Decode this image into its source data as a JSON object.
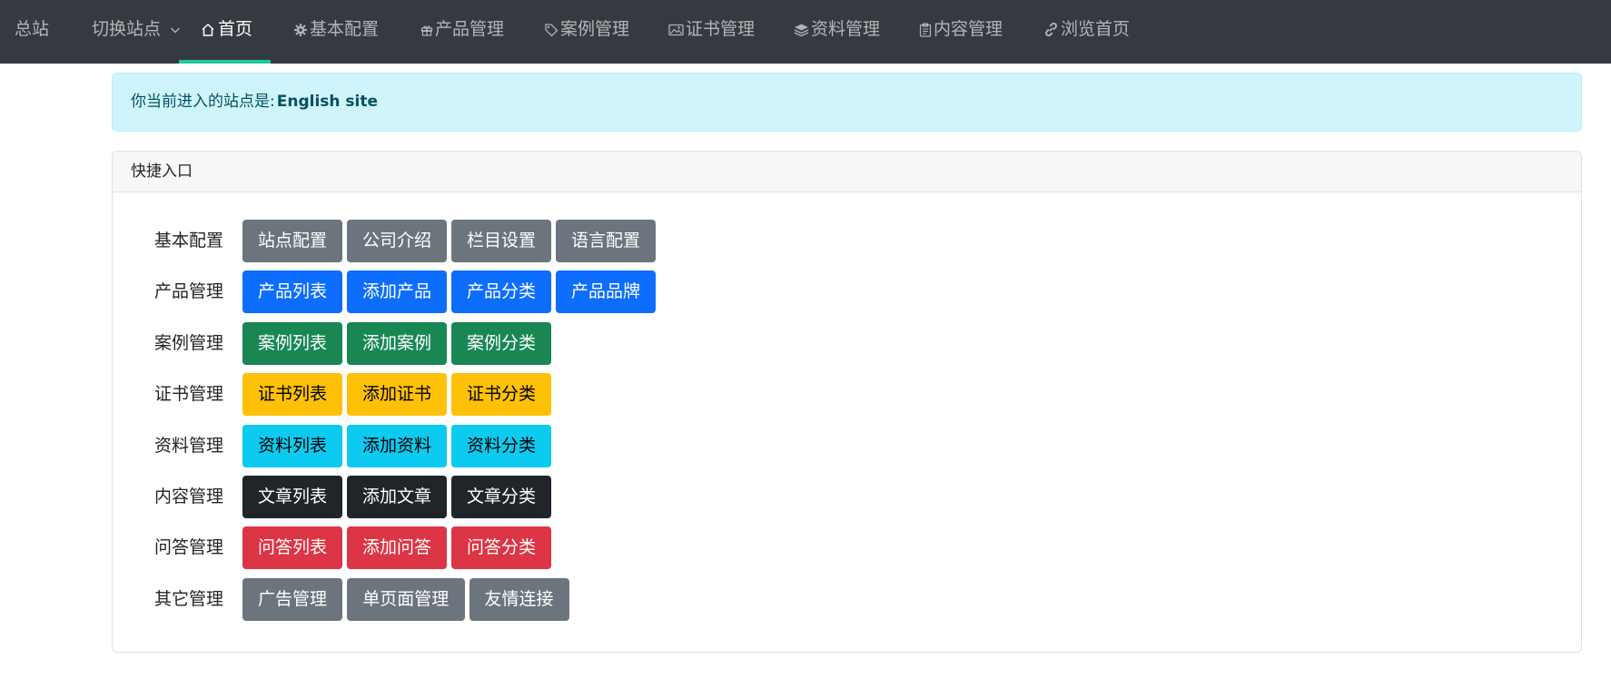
{
  "nav": {
    "brand": "总站",
    "switch_site": "切换站点",
    "items": [
      {
        "label": "首页",
        "icon": "home-icon"
      },
      {
        "label": "基本配置",
        "icon": "gear-icon"
      },
      {
        "label": "产品管理",
        "icon": "gift-icon"
      },
      {
        "label": "案例管理",
        "icon": "tag-icon"
      },
      {
        "label": "证书管理",
        "icon": "image-icon"
      },
      {
        "label": "资料管理",
        "icon": "layers-icon"
      },
      {
        "label": "内容管理",
        "icon": "clipboard-icon"
      },
      {
        "label": "浏览首页",
        "icon": "link-icon"
      }
    ],
    "active_index": 0,
    "underline_color": "#20c997"
  },
  "alert": {
    "prefix": "你当前进入的站点是:",
    "site_name": "English site"
  },
  "quick_entry": {
    "title": "快捷入口",
    "groups": [
      {
        "label": "基本配置",
        "style": "secondary",
        "buttons": [
          "站点配置",
          "公司介绍",
          "栏目设置",
          "语言配置"
        ]
      },
      {
        "label": "产品管理",
        "style": "primary",
        "buttons": [
          "产品列表",
          "添加产品",
          "产品分类",
          "产品品牌"
        ]
      },
      {
        "label": "案例管理",
        "style": "success",
        "buttons": [
          "案例列表",
          "添加案例",
          "案例分类"
        ]
      },
      {
        "label": "证书管理",
        "style": "warning",
        "buttons": [
          "证书列表",
          "添加证书",
          "证书分类"
        ]
      },
      {
        "label": "资料管理",
        "style": "info",
        "buttons": [
          "资料列表",
          "添加资料",
          "资料分类"
        ]
      },
      {
        "label": "内容管理",
        "style": "dark",
        "buttons": [
          "文章列表",
          "添加文章",
          "文章分类"
        ]
      },
      {
        "label": "问答管理",
        "style": "danger",
        "buttons": [
          "问答列表",
          "添加问答",
          "问答分类"
        ]
      },
      {
        "label": "其它管理",
        "style": "secondary",
        "buttons": [
          "广告管理",
          "单页面管理",
          "友情连接"
        ]
      }
    ]
  },
  "colors": {
    "nav_bg": "#343a40",
    "alert_bg": "#cff4fc",
    "alert_text": "#055160",
    "secondary": "#6c757d",
    "primary": "#0d6efd",
    "success": "#198754",
    "warning": "#ffc107",
    "info": "#0dcaf0",
    "dark": "#212529",
    "danger": "#dc3545"
  }
}
